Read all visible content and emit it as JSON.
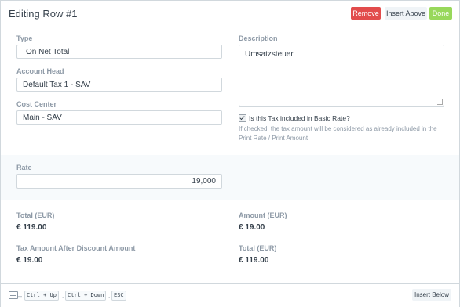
{
  "header": {
    "title": "Editing Row #1",
    "remove_label": "Remove",
    "insert_above_label": "Insert Above",
    "done_label": "Done"
  },
  "fields": {
    "type": {
      "label": "Type",
      "value": "On Net Total"
    },
    "account_head": {
      "label": "Account Head",
      "value": "Default Tax 1 - SAV"
    },
    "cost_center": {
      "label": "Cost Center",
      "value": "Main - SAV"
    },
    "description": {
      "label": "Description",
      "value": "Umsatzsteuer"
    },
    "included": {
      "label": "Is this Tax included in Basic Rate?",
      "checked": true,
      "help": "If checked, the tax amount will be considered as already included in the Print Rate / Print Amount"
    },
    "rate": {
      "label": "Rate",
      "value": "19,000"
    }
  },
  "summary": {
    "total_left": {
      "label": "Total (EUR)",
      "value": "€ 119.00"
    },
    "amount": {
      "label": "Amount (EUR)",
      "value": "€ 19.00"
    },
    "tax_after_discount": {
      "label": "Tax Amount After Discount Amount",
      "value": "€ 19.00"
    },
    "total_right": {
      "label": "Total (EUR)",
      "value": "€ 119.00"
    }
  },
  "footer": {
    "dash": "–",
    "shortcuts": [
      "Ctrl + Up",
      "Ctrl + Down",
      "ESC"
    ],
    "insert_below_label": "Insert Below"
  },
  "colors": {
    "remove": "#e24c4c",
    "done": "#98d85b",
    "section_bg": "#f7fafc"
  },
  "icons": [
    "keyboard-icon",
    "checkmark-icon"
  ]
}
